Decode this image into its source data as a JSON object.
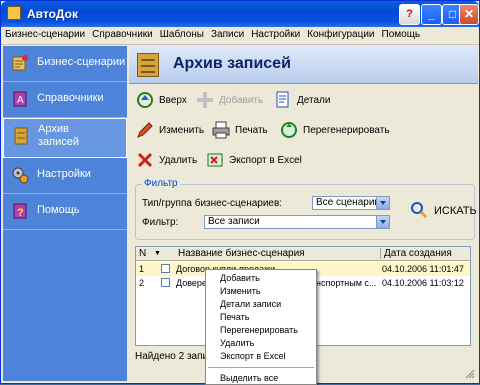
{
  "window": {
    "title": "АвтоДок",
    "help_label": "?",
    "min_label": "_",
    "max_label": "□",
    "close_label": "✕"
  },
  "menu": [
    "Бизнес-сценарии",
    "Справочники",
    "Шаблоны",
    "Записи",
    "Настройки",
    "Конфигурации",
    "Помощь"
  ],
  "sidebar": {
    "items": [
      {
        "label": "Бизнес-сценарии",
        "icon": "scenario-icon"
      },
      {
        "label": "Справочники",
        "icon": "reference-book-icon"
      },
      {
        "label": "Архив записей",
        "icon": "archive-cabinet-icon",
        "active": true
      },
      {
        "label": "Настройки",
        "icon": "gears-icon"
      },
      {
        "label": "Помощь",
        "icon": "help-book-icon"
      }
    ]
  },
  "header": {
    "title": "Архив записей"
  },
  "toolbar": {
    "up": "Вверх",
    "add": "Добавить",
    "details": "Детали",
    "edit": "Изменить",
    "print": "Печать",
    "regenerate": "Перегенерировать",
    "delete": "Удалить",
    "export": "Экспорт в Excel"
  },
  "filter": {
    "legend": "Фильтр",
    "type_label": "Тип/группа бизнес-сценариев:",
    "type_value": "Все сценарии",
    "filter_label": "Фильтр:",
    "filter_value": "Все записи",
    "search_label": "ИСКАТЬ"
  },
  "table": {
    "headers": {
      "n": "N",
      "sort": "▼",
      "name": "Название бизнес-сценария",
      "date": "Дата создания"
    },
    "rows": [
      {
        "n": "1",
        "name": "Договор купли-продажи",
        "date": "04.10.2006 11:01:47"
      },
      {
        "n": "2",
        "name": "Доверенность на управление транспортным с...",
        "date": "04.10.2006 11:03:12"
      }
    ]
  },
  "footer": {
    "found": "Найдено 2 записи"
  },
  "context_menu": {
    "items": [
      "Добавить",
      "Изменить",
      "Детали записи",
      "Печать",
      "Перегенерировать",
      "Удалить",
      "Экспорт в Excel"
    ],
    "select_all": "Выделить все"
  }
}
